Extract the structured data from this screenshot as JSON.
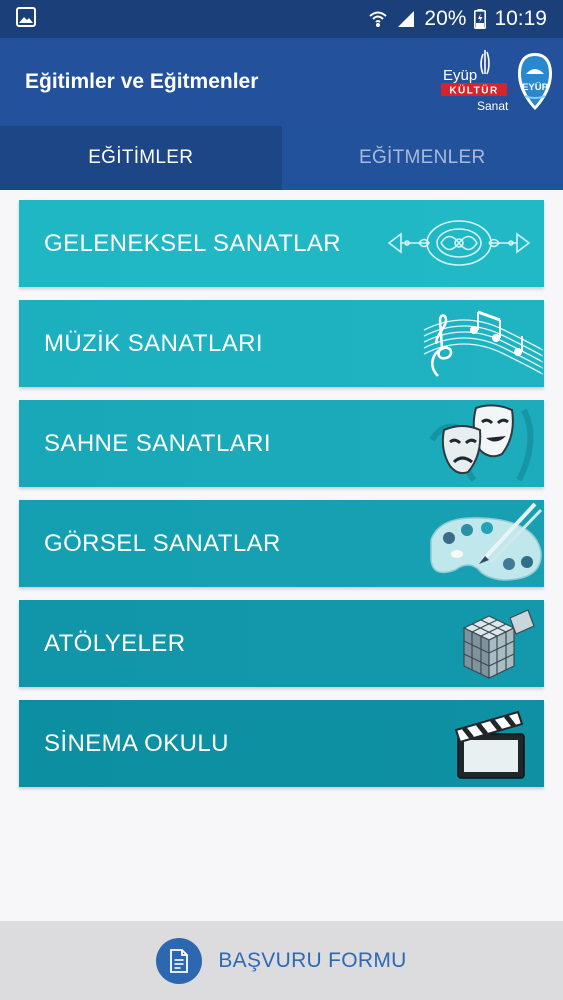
{
  "status_bar": {
    "battery_percent": "20%",
    "time": "10:19"
  },
  "app_bar": {
    "title": "Eğitimler ve Eğitmenler",
    "logo_kultur_line1": "Eyüp",
    "logo_kultur_line2": "KÜLTÜR",
    "logo_kultur_line3": "Sanat",
    "logo_eyup": "EYÜP"
  },
  "tabs": [
    {
      "label": "EĞİTİMLER",
      "active": true
    },
    {
      "label": "EĞİTMENLER",
      "active": false
    }
  ],
  "categories": [
    {
      "label": "GELENEKSEL SANATLAR",
      "icon": "ornament-icon"
    },
    {
      "label": "MÜZİK SANATLARI",
      "icon": "music-notes-icon"
    },
    {
      "label": "SAHNE SANATLARI",
      "icon": "theater-masks-icon"
    },
    {
      "label": "GÖRSEL SANATLAR",
      "icon": "paint-palette-icon"
    },
    {
      "label": "ATÖLYELER",
      "icon": "cube-icon"
    },
    {
      "label": "SİNEMA OKULU",
      "icon": "clapperboard-icon"
    }
  ],
  "bottom": {
    "label": "BAŞVURU FORMU",
    "icon": "document-icon"
  },
  "colors": {
    "status_bar": "#1b3f78",
    "app_bar": "#23519b",
    "tab_active": "#1d4686",
    "card_teal": "#1fb7c4",
    "bottom_accent": "#2d67b0"
  }
}
